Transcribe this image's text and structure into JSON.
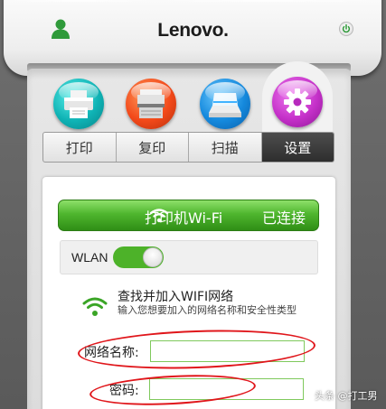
{
  "header": {
    "brand": "Lenovo.",
    "user_icon": "user-icon",
    "power_icon": "power-icon"
  },
  "app_icons": [
    {
      "name": "printer-icon",
      "color": "#0fb3b5"
    },
    {
      "name": "copier-icon",
      "color": "#f2491a"
    },
    {
      "name": "scanner-icon",
      "color": "#1589dd"
    },
    {
      "name": "gear-icon",
      "color": "#c531c9"
    }
  ],
  "tabs": [
    {
      "label": "打印",
      "active": false
    },
    {
      "label": "复印",
      "active": false
    },
    {
      "label": "扫描",
      "active": false
    },
    {
      "label": "设置",
      "active": true
    }
  ],
  "wifi_bar": {
    "title": "打印机Wi-Fi",
    "status": "已连接",
    "icon": "wifi-icon",
    "color": "#4fb62e"
  },
  "wlan": {
    "label": "WLAN",
    "enabled": true
  },
  "form": {
    "title": "查找并加入WIFI网络",
    "description": "输入您想要加入的网络名称和安全性类型",
    "network_name_label": "网络名称:",
    "network_name_value": "",
    "password_label": "密码:",
    "password_value": ""
  },
  "annotation_color": "#e0161b",
  "watermark": "头条 @打工男"
}
